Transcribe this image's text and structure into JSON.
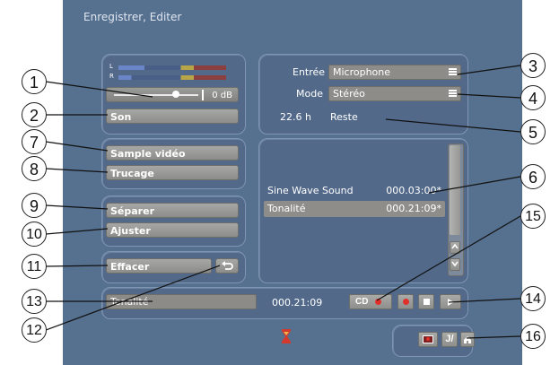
{
  "window": {
    "title": "Enregistrer, Editer"
  },
  "meter": {
    "left_label": "L",
    "right_label": "R",
    "db_value": "0 dB",
    "level": 0.73
  },
  "buttons": {
    "son": "Son",
    "sample_video": "Sample vidéo",
    "trucage": "Trucage",
    "separer": "Séparer",
    "ajuster": "Ajuster",
    "effacer": "Effacer"
  },
  "input": {
    "label": "Entrée",
    "value": "Microphone"
  },
  "mode": {
    "label": "Mode",
    "value": "Stéréo"
  },
  "remaining": {
    "value": "22.6 h",
    "label": "Reste"
  },
  "tracks": [
    {
      "name": "Sine Wave Sound",
      "time": "000.03:00*",
      "selected": false
    },
    {
      "name": "Tonalité",
      "time": "000.21:09*",
      "selected": true
    }
  ],
  "transport": {
    "name": "Tonalité",
    "time": "000.21:09",
    "cd_label": "CD"
  },
  "callouts": [
    "1",
    "2",
    "3",
    "4",
    "5",
    "6",
    "7",
    "8",
    "9",
    "10",
    "11",
    "12",
    "13",
    "14",
    "15",
    "16"
  ],
  "icons": {
    "undo": "undo-icon",
    "record_cd": "record-dot-icon",
    "record": "record-dot-icon",
    "stop": "stop-icon",
    "play": "play-icon",
    "scroll_up": "chevron-up-icon",
    "scroll_down": "chevron-down-icon",
    "menu": "menu-lines-icon",
    "hourglass": "hourglass-icon",
    "monitor": "monitor-icon",
    "tools": "tools-icon",
    "home": "home-icon"
  },
  "colors": {
    "background": "#56708f",
    "button": "#9a9b98",
    "accent_red": "#e0302a",
    "selected_row": "#8e8d8a"
  }
}
